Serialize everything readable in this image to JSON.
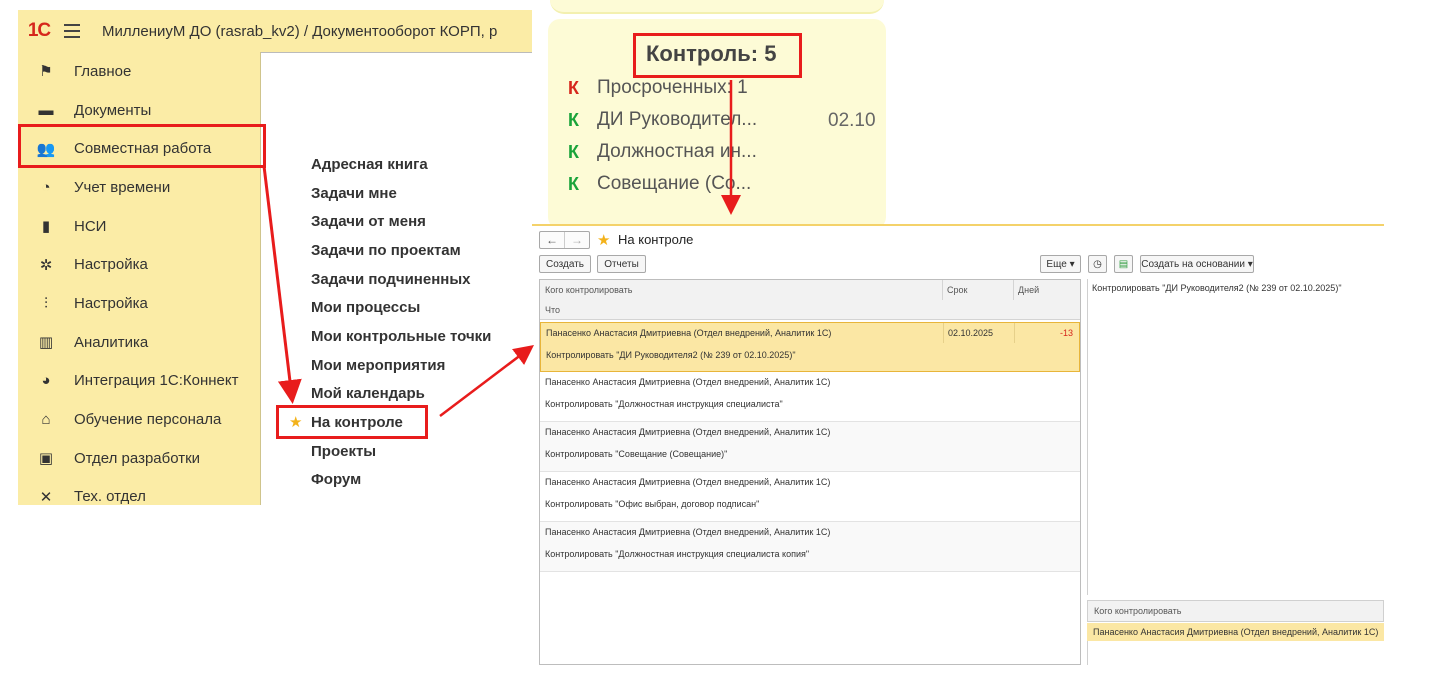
{
  "app": {
    "logo": "1С",
    "title": "МиллениуМ ДО (rasrab_kv2) / Документооборот КОРП, р"
  },
  "sidebar": {
    "items": [
      {
        "label": "Главное",
        "icon": "flag-icon",
        "glyph": "⚑"
      },
      {
        "label": "Документы",
        "icon": "folder-icon",
        "glyph": "▬"
      },
      {
        "label": "Совместная работа",
        "icon": "people-icon",
        "glyph": "👥"
      },
      {
        "label": "Учет времени",
        "icon": "clock-icon",
        "glyph": "◔"
      },
      {
        "label": "НСИ",
        "icon": "book-icon",
        "glyph": "▮"
      },
      {
        "label": "Настройка",
        "icon": "gear-icon",
        "glyph": "✲"
      },
      {
        "label": "Настройка",
        "icon": "sliders-icon",
        "glyph": "⫶"
      },
      {
        "label": "Аналитика",
        "icon": "bar-chart-icon",
        "glyph": "▥"
      },
      {
        "label": "Интеграция 1С:Коннект",
        "icon": "connect-icon",
        "glyph": "◕"
      },
      {
        "label": "Обучение персонала",
        "icon": "graduation-icon",
        "glyph": "⌂"
      },
      {
        "label": "Отдел разработки",
        "icon": "code-window-icon",
        "glyph": "▣"
      },
      {
        "label": "Тех. отдел",
        "icon": "tools-icon",
        "glyph": "✕"
      }
    ]
  },
  "submenu": {
    "items": [
      "Адресная книга",
      "Задачи мне",
      "Задачи от меня",
      "Задачи по проектам",
      "Задачи подчиненных",
      "Мои процессы",
      "Мои контрольные точки",
      "Мои мероприятия",
      "Мой календарь",
      "На контроле",
      "Проекты",
      "Форум"
    ]
  },
  "widget": {
    "title": "Контроль: 5",
    "rows": [
      {
        "mark": "К",
        "color": "#d6271c",
        "text": "Просроченных: 1",
        "date": ""
      },
      {
        "mark": "К",
        "color": "#1aa33a",
        "text": "ДИ Руководител...",
        "date": "02.10"
      },
      {
        "mark": "К",
        "color": "#1aa33a",
        "text": "Должностная ин...",
        "date": ""
      },
      {
        "mark": "К",
        "color": "#1aa33a",
        "text": "Совещание  (Со...",
        "date": ""
      }
    ]
  },
  "form": {
    "title": "На контроле",
    "nav_back": "←",
    "nav_forward": "→",
    "buttons": {
      "create": "Создать",
      "reports": "Отчеты",
      "more": "Еще",
      "create_based": "Создать на основании"
    },
    "columns": {
      "who": "Кого контролировать",
      "deadline": "Срок",
      "days": "Дней",
      "what": "Что"
    },
    "rows": [
      {
        "who": "Панасенко Анастасия Дмитриевна (Отдел внедрений, Аналитик 1С)",
        "what": "Контролировать \"ДИ Руководителя2 (№ 239 от 02.10.2025)\"",
        "deadline": "02.10.2025",
        "days": "-13"
      },
      {
        "who": "Панасенко Анастасия Дмитриевна (Отдел внедрений, Аналитик 1С)",
        "what": "Контролировать \"Должностная инструкция специалиста\"",
        "deadline": "",
        "days": ""
      },
      {
        "who": "Панасенко Анастасия Дмитриевна (Отдел внедрений, Аналитик 1С)",
        "what": "Контролировать \"Совещание (Совещание)\"",
        "deadline": "",
        "days": ""
      },
      {
        "who": "Панасенко Анастасия Дмитриевна (Отдел внедрений, Аналитик 1С)",
        "what": "Контролировать \"Офис выбран, договор подписан\"",
        "deadline": "",
        "days": ""
      },
      {
        "who": "Панасенко Анастасия Дмитриевна (Отдел внедрений, Аналитик 1С)",
        "what": "Контролировать \"Должностная инструкция специалиста копия\"",
        "deadline": "",
        "days": ""
      }
    ],
    "preview_text": "Контролировать \"ДИ Руководителя2 (№ 239 от 02.10.2025)\"",
    "side_grid": {
      "header": "Кого контролировать",
      "row": "Панасенко Анастасия Дмитриевна (Отдел внедрений, Аналитик 1С)"
    }
  },
  "colors": {
    "accent_yellow": "#fbeca6",
    "highlight_red": "#e81c1c",
    "overdue_red": "#d6271c",
    "ok_green": "#1aa33a",
    "star": "#f3b21b"
  }
}
